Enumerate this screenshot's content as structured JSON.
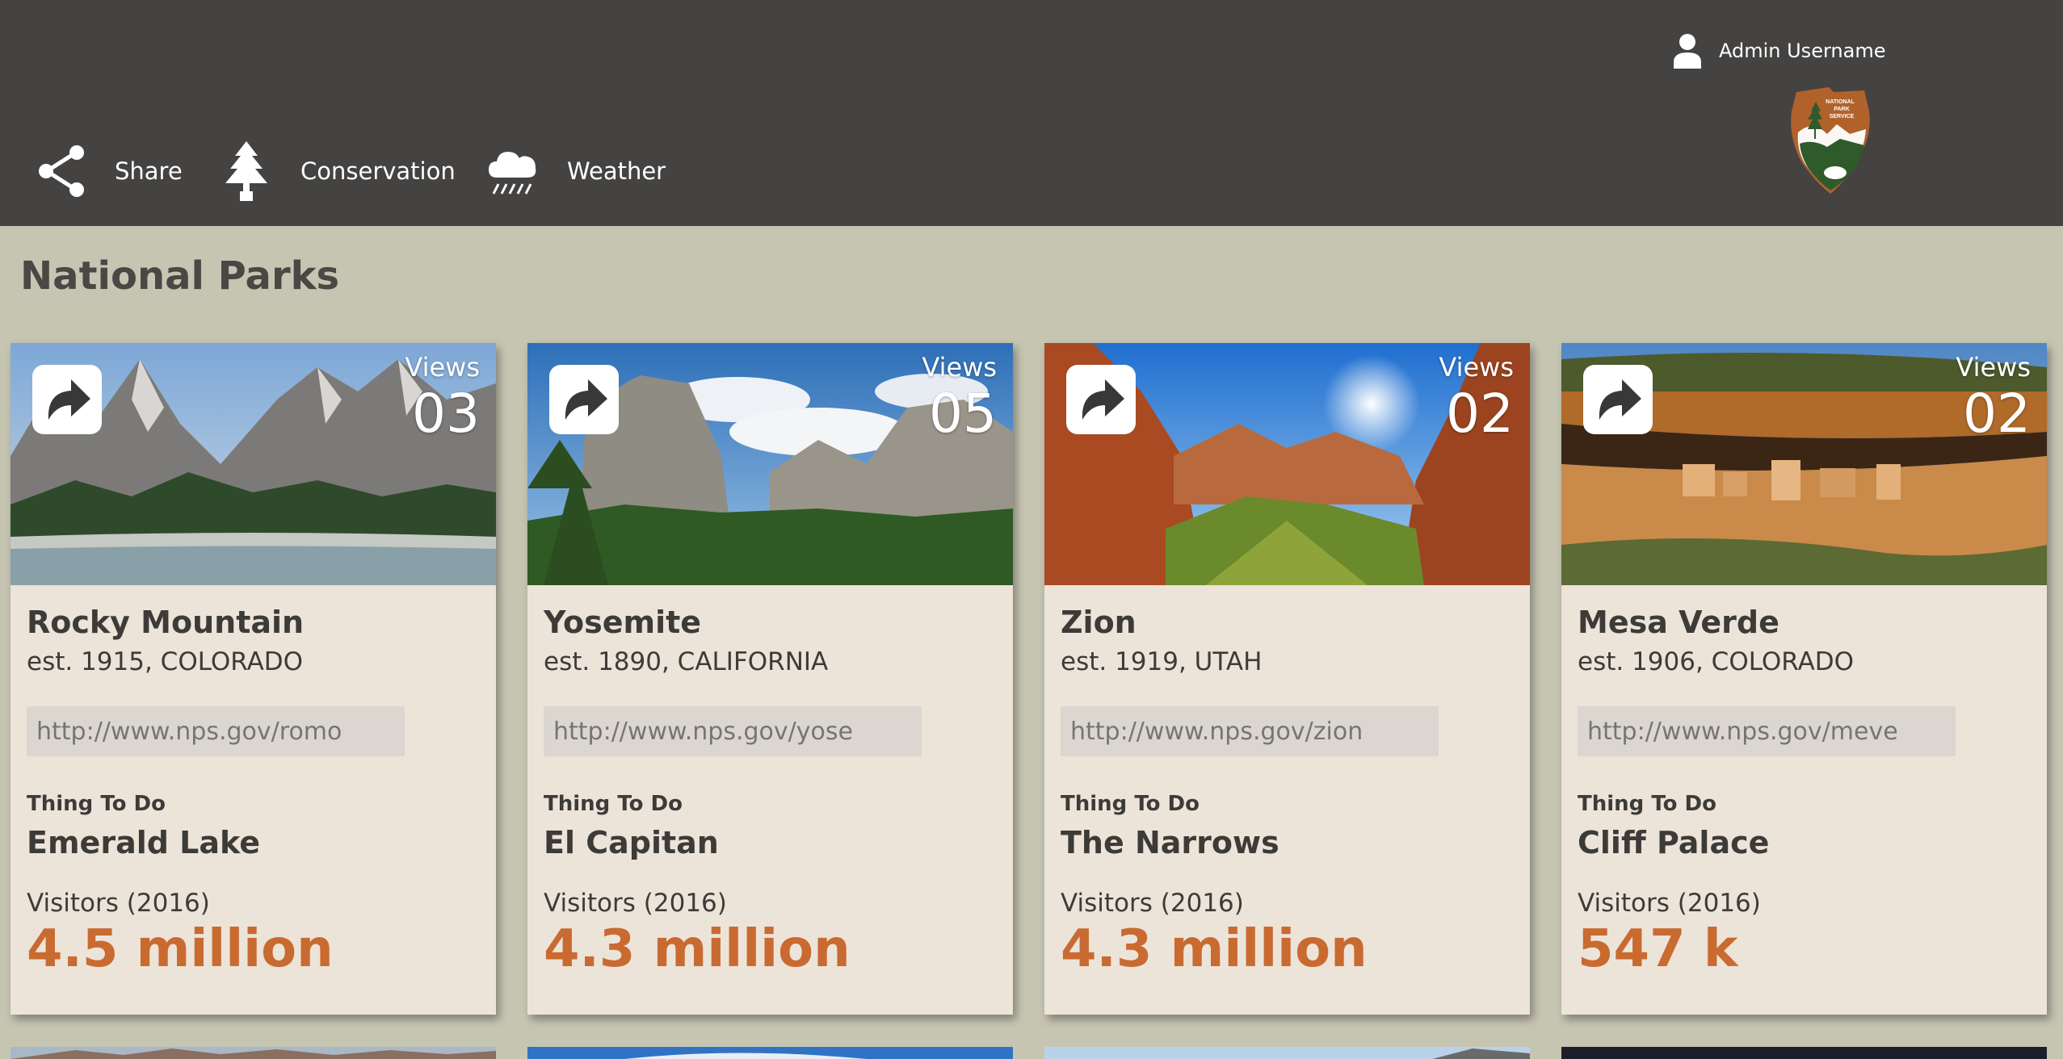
{
  "header": {
    "username": "Admin Username",
    "nav": [
      {
        "label": "Share",
        "icon": "share-icon"
      },
      {
        "label": "Conservation",
        "icon": "tree-icon"
      },
      {
        "label": "Weather",
        "icon": "weather-cloud-rain-icon"
      }
    ],
    "logo_text": [
      "NATIONAL",
      "PARK",
      "SERVICE"
    ]
  },
  "page_title": "National Parks",
  "cards": [
    {
      "name": "Rocky Mountain",
      "est": "est. 1915, COLORADO",
      "url": "http://www.nps.gov/romo",
      "views_label": "Views",
      "views": "03",
      "todo_label": "Thing To Do",
      "todo": "Emerald Lake",
      "visitors_label": "Visitors (2016)",
      "visitors": "4.5 million"
    },
    {
      "name": "Yosemite",
      "est": "est. 1890, CALIFORNIA",
      "url": "http://www.nps.gov/yose",
      "views_label": "Views",
      "views": "05",
      "todo_label": "Thing To Do",
      "todo": "El Capitan",
      "visitors_label": "Visitors (2016)",
      "visitors": "4.3 million"
    },
    {
      "name": "Zion",
      "est": "est. 1919, UTAH",
      "url": "http://www.nps.gov/zion",
      "views_label": "Views",
      "views": "02",
      "todo_label": "Thing To Do",
      "todo": "The Narrows",
      "visitors_label": "Visitors (2016)",
      "visitors": "4.3 million"
    },
    {
      "name": "Mesa Verde",
      "est": "est. 1906, COLORADO",
      "url": "http://www.nps.gov/meve",
      "views_label": "Views",
      "views": "02",
      "todo_label": "Thing To Do",
      "todo": "Cliff Palace",
      "visitors_label": "Visitors (2016)",
      "visitors": "547 k"
    }
  ],
  "colors": {
    "header_bg": "#444342",
    "page_bg": "#c6c5b2",
    "card_bg": "#ece4d9",
    "accent_orange": "#c96a31",
    "text_dark": "#3d3b38"
  }
}
